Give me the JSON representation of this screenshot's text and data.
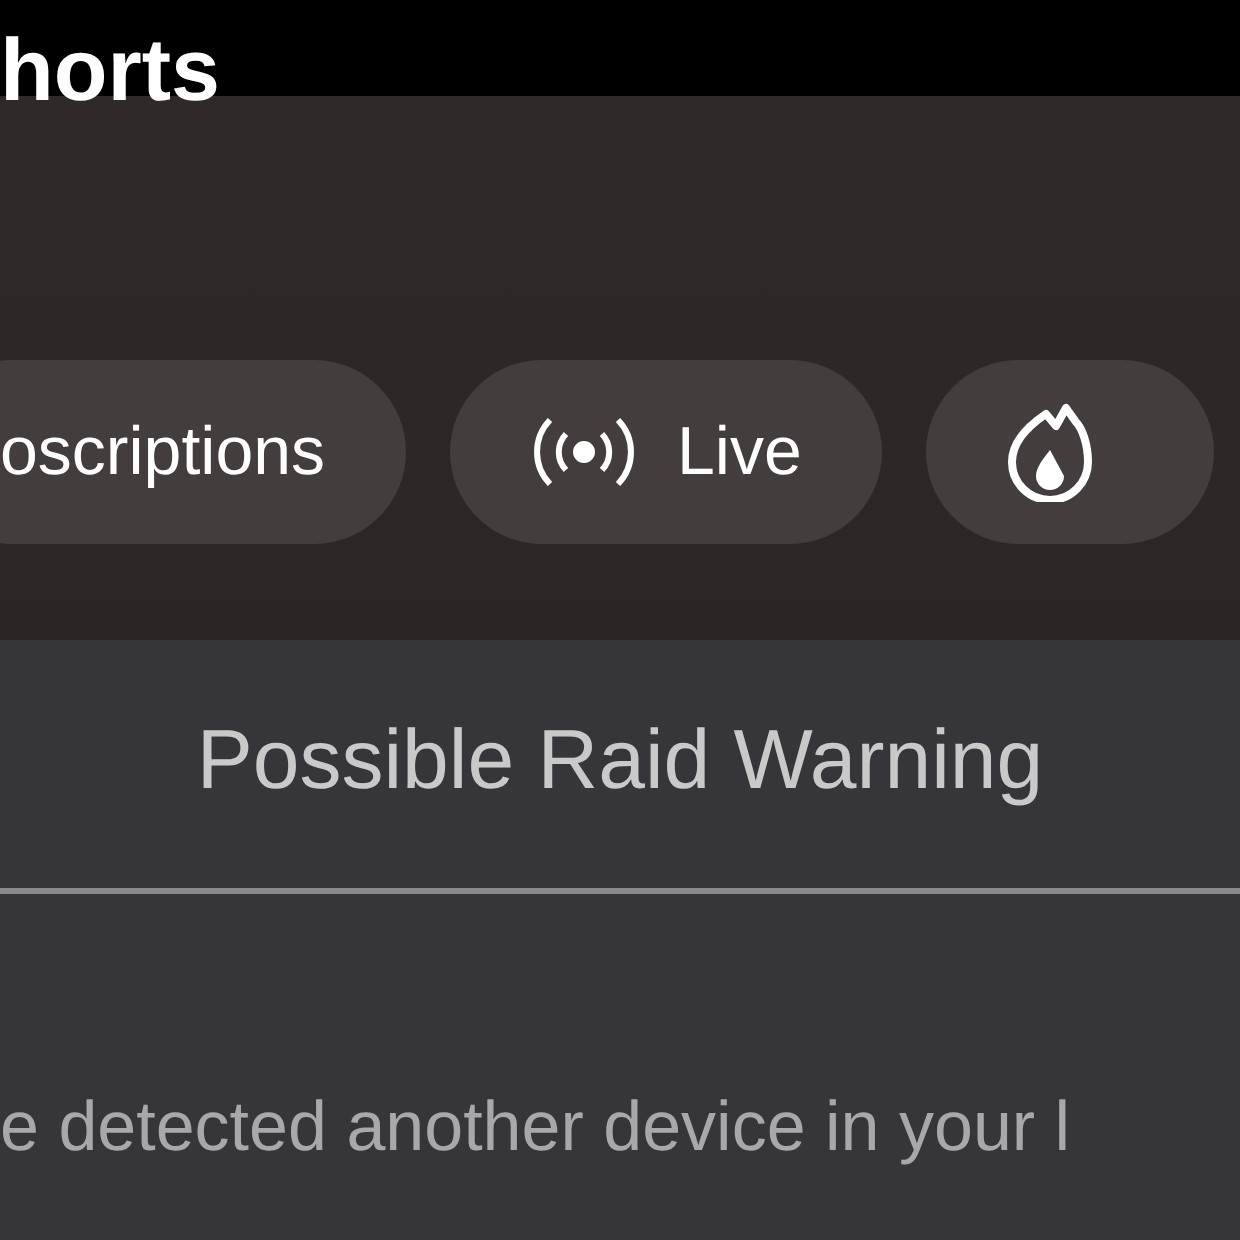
{
  "header": {
    "title": "horts"
  },
  "chips": [
    {
      "label": "oscriptions",
      "kind": "text"
    },
    {
      "label": "Live",
      "kind": "live"
    },
    {
      "kind": "flame"
    }
  ],
  "dialog": {
    "title": "Possible Raid Warning",
    "lines": [
      "e detected another device in your l"
    ]
  }
}
